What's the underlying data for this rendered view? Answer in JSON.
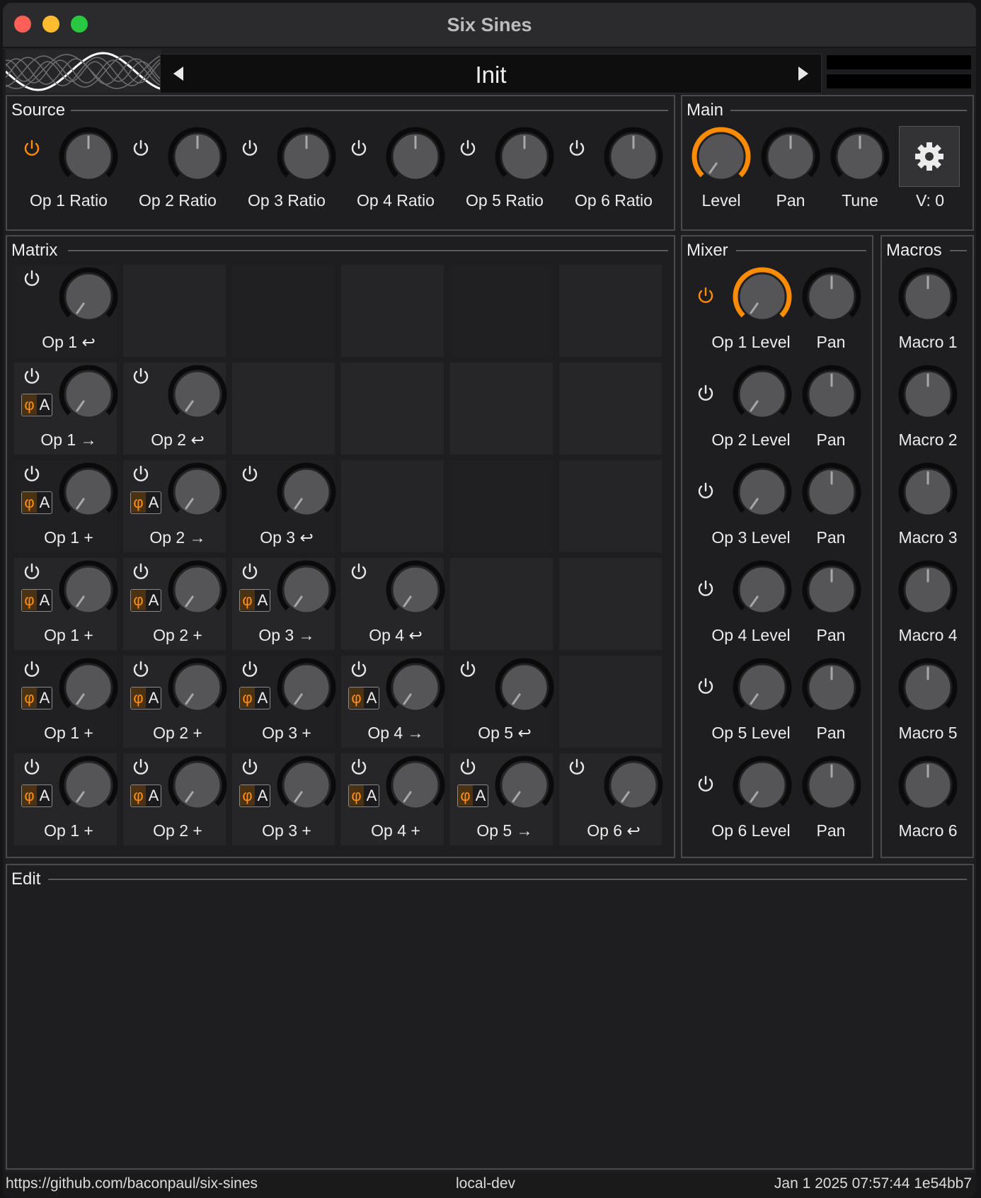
{
  "window": {
    "title": "Six Sines",
    "controls": [
      "close",
      "minimize",
      "zoom"
    ]
  },
  "header": {
    "preset_name": "Init",
    "prev_icon": "triangle-left-icon",
    "next_icon": "triangle-right-icon",
    "logo": "sine-waves-logo"
  },
  "source": {
    "title": "Source",
    "ops": [
      {
        "label": "Op 1 Ratio",
        "power_on": true
      },
      {
        "label": "Op 2 Ratio",
        "power_on": false
      },
      {
        "label": "Op 3 Ratio",
        "power_on": false
      },
      {
        "label": "Op 4 Ratio",
        "power_on": false
      },
      {
        "label": "Op 5 Ratio",
        "power_on": false
      },
      {
        "label": "Op 6 Ratio",
        "power_on": false
      }
    ]
  },
  "main": {
    "title": "Main",
    "level_label": "Level",
    "pan_label": "Pan",
    "tune_label": "Tune",
    "voices_label": "V: 0",
    "settings_icon": "gear-icon",
    "accent_color": "#ff8c00"
  },
  "matrix": {
    "title": "Matrix",
    "rows": [
      [
        {
          "label": "Op 1 ↩",
          "phase": false
        }
      ],
      [
        {
          "label": "Op 1 →",
          "phase": true
        },
        {
          "label": "Op 2 ↩",
          "phase": false
        }
      ],
      [
        {
          "label": "Op 1 +",
          "phase": true
        },
        {
          "label": "Op 2 →",
          "phase": true
        },
        {
          "label": "Op 3 ↩",
          "phase": false
        }
      ],
      [
        {
          "label": "Op 1 +",
          "phase": true
        },
        {
          "label": "Op 2 +",
          "phase": true
        },
        {
          "label": "Op 3 →",
          "phase": true
        },
        {
          "label": "Op 4 ↩",
          "phase": false
        }
      ],
      [
        {
          "label": "Op 1 +",
          "phase": true
        },
        {
          "label": "Op 2 +",
          "phase": true
        },
        {
          "label": "Op 3 +",
          "phase": true
        },
        {
          "label": "Op 4 →",
          "phase": true
        },
        {
          "label": "Op 5 ↩",
          "phase": false
        }
      ],
      [
        {
          "label": "Op 1 +",
          "phase": true
        },
        {
          "label": "Op 2 +",
          "phase": true
        },
        {
          "label": "Op 3 +",
          "phase": true
        },
        {
          "label": "Op 4 +",
          "phase": true
        },
        {
          "label": "Op 5 →",
          "phase": true
        },
        {
          "label": "Op 6 ↩",
          "phase": false
        }
      ]
    ],
    "phase_symbol": "φ",
    "phase_letter": "A"
  },
  "mixer": {
    "title": "Mixer",
    "rows": [
      {
        "level_label": "Op 1 Level",
        "pan_label": "Pan",
        "power_on": true
      },
      {
        "level_label": "Op 2 Level",
        "pan_label": "Pan",
        "power_on": false
      },
      {
        "level_label": "Op 3 Level",
        "pan_label": "Pan",
        "power_on": false
      },
      {
        "level_label": "Op 4 Level",
        "pan_label": "Pan",
        "power_on": false
      },
      {
        "level_label": "Op 5 Level",
        "pan_label": "Pan",
        "power_on": false
      },
      {
        "level_label": "Op 6 Level",
        "pan_label": "Pan",
        "power_on": false
      }
    ]
  },
  "macros": {
    "title": "Macros",
    "items": [
      "Macro 1",
      "Macro 2",
      "Macro 3",
      "Macro 4",
      "Macro 5",
      "Macro 6"
    ]
  },
  "edit": {
    "title": "Edit"
  },
  "status": {
    "url": "https://github.com/baconpaul/six-sines",
    "build": "local-dev",
    "version": "Jan  1 2025 07:57:44 1e54bb7"
  },
  "colors": {
    "accent": "#ff8c00",
    "panel": "#1e1e20",
    "border": "#4a4a4d"
  }
}
